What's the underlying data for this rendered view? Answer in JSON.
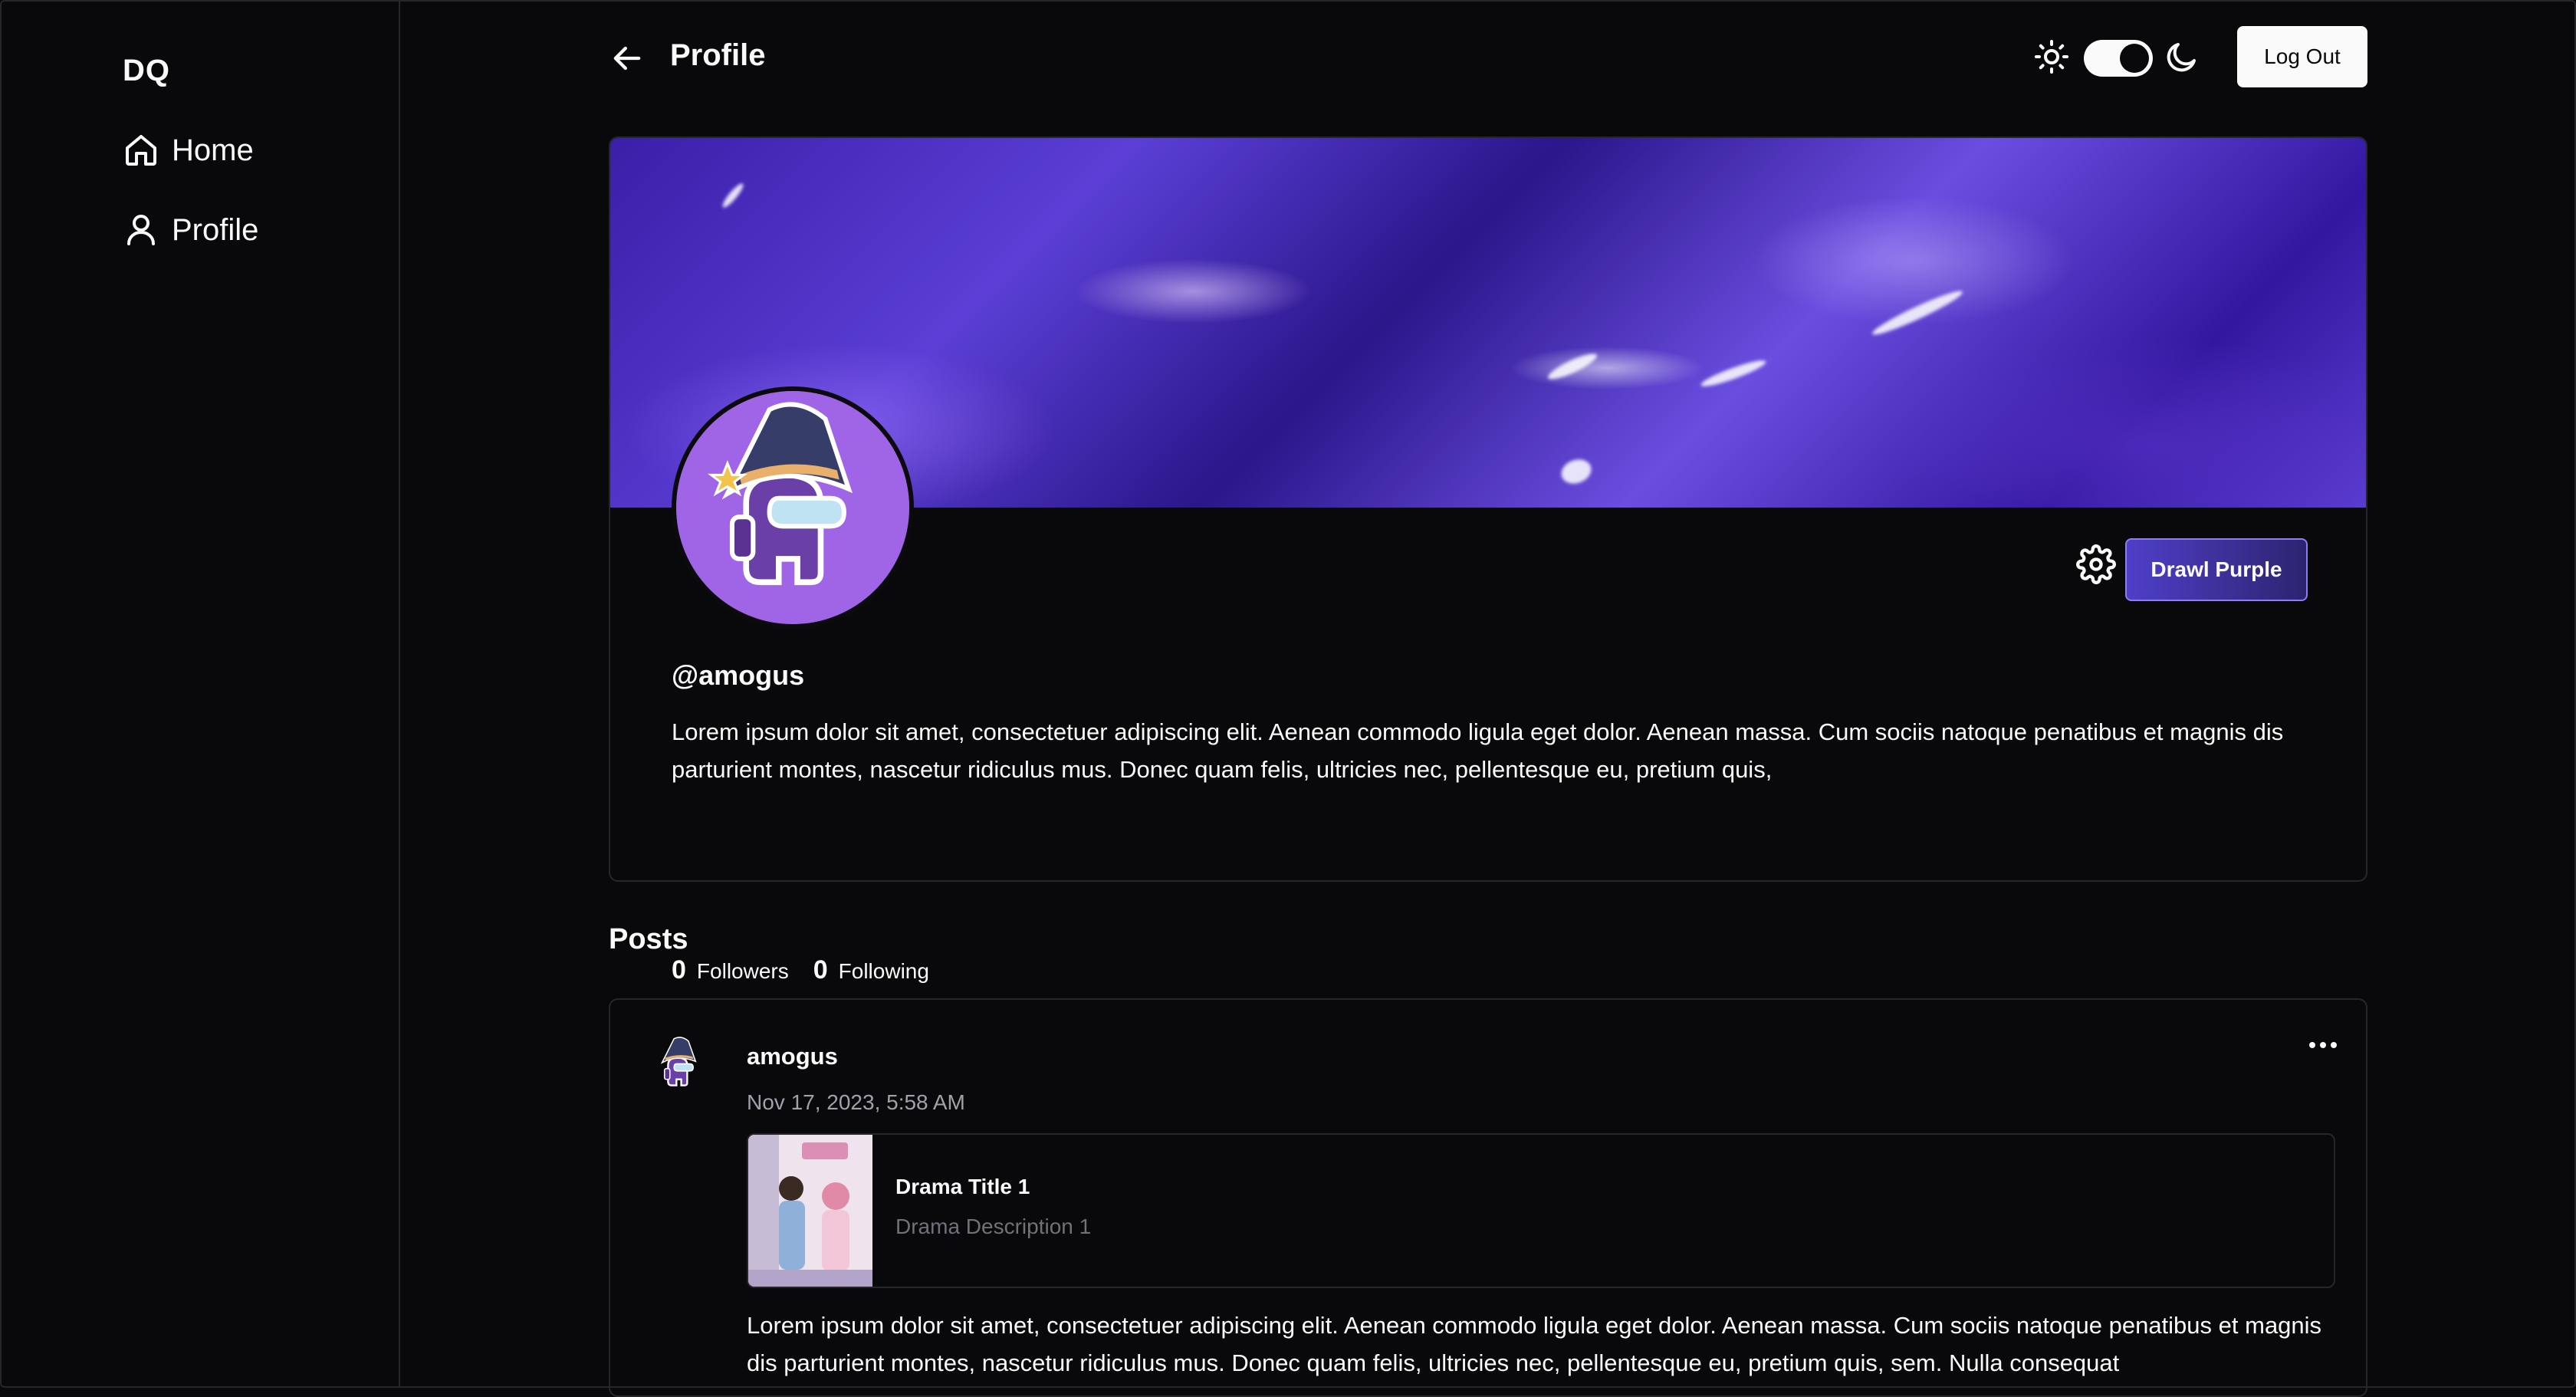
{
  "sidebar": {
    "logo": "DQ",
    "items": [
      {
        "label": "Home",
        "icon": "home-icon"
      },
      {
        "label": "Profile",
        "icon": "user-icon"
      }
    ]
  },
  "header": {
    "title": "Profile",
    "logout_label": "Log Out",
    "theme_toggle": "dark"
  },
  "profile": {
    "handle": "@amogus",
    "bio": "Lorem ipsum dolor sit amet, consectetuer adipiscing elit. Aenean commodo ligula eget dolor. Aenean massa. Cum sociis natoque penatibus et magnis dis parturient montes, nascetur ridiculus mus. Donec quam felis, ultricies nec, pellentesque eu, pretium quis,",
    "followers_count": "0",
    "followers_label": "Followers",
    "following_count": "0",
    "following_label": "Following",
    "theme_button_label": "Drawl Purple"
  },
  "posts": {
    "title": "Posts",
    "items": [
      {
        "author": "amogus",
        "date": "Nov 17, 2023, 5:58 AM",
        "drama": {
          "title": "Drama Title 1",
          "description": "Drama Description 1"
        },
        "body": "Lorem ipsum dolor sit amet, consectetuer adipiscing elit. Aenean commodo ligula eget dolor. Aenean massa. Cum sociis natoque penatibus et magnis dis parturient montes, nascetur ridiculus mus. Donec quam felis, ultricies nec, pellentesque eu, pretium quis, sem. Nulla consequat"
      }
    ]
  },
  "colors": {
    "background": "#09090b",
    "border": "#27272a",
    "accent": "#4f3fc9",
    "muted_text": "#a1a1aa"
  }
}
